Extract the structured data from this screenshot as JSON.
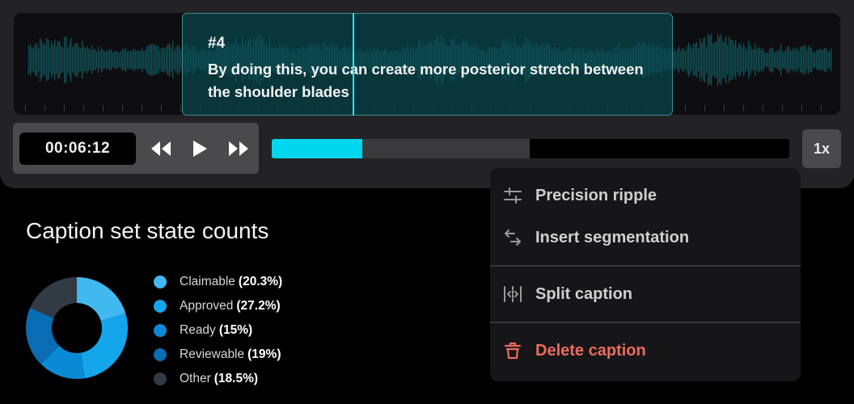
{
  "caption": {
    "number": "#4",
    "text": "By doing this, you can create more posterior stretch between the shoulder blades"
  },
  "player": {
    "timecode": "00:06:12",
    "rewind_icon": "rewind-icon",
    "play_icon": "play-icon",
    "forward_icon": "fast-forward-icon",
    "played_fraction": 0.175,
    "buffered_fraction": 0.498,
    "speed_label": "1x"
  },
  "donut_section": {
    "title": "Caption set state counts",
    "chart_data": {
      "type": "pie",
      "donut": true,
      "slices": [
        {
          "label": "Claimable",
          "value": 20.3,
          "value_label": "(20.3%)",
          "color": "#42b8f0"
        },
        {
          "label": "Approved",
          "value": 27.2,
          "value_label": "(27.2%)",
          "color": "#13a6ea"
        },
        {
          "label": "Ready",
          "value": 15.0,
          "value_label": "(15%)",
          "color": "#0a8ad5"
        },
        {
          "label": "Reviewable",
          "value": 19.0,
          "value_label": "(19%)",
          "color": "#0a6cb3"
        },
        {
          "label": "Other",
          "value": 18.5,
          "value_label": "(18.5%)",
          "color": "#323b44"
        }
      ]
    }
  },
  "context_menu": {
    "items": [
      {
        "label": "Precision ripple",
        "icon": "sliders-icon"
      },
      {
        "label": "Insert segmentation",
        "icon": "swap-arrows-icon"
      },
      {
        "label": "Split caption",
        "icon": "split-icon"
      },
      {
        "label": "Delete caption",
        "icon": "trash-icon",
        "color": "#ec6b5d"
      }
    ]
  }
}
